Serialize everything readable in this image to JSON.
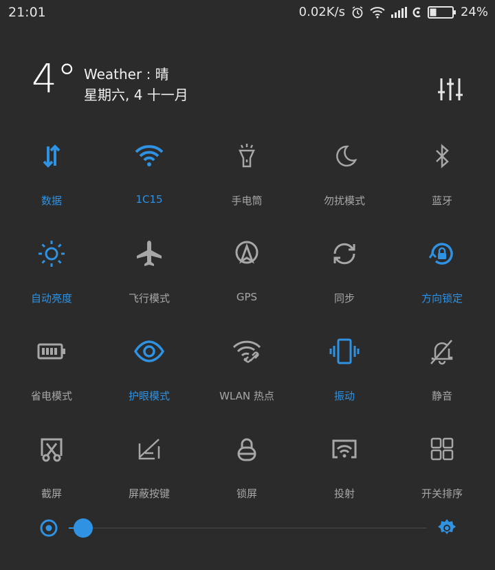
{
  "status_bar": {
    "time": "21:01",
    "net_speed": "0.02K/s",
    "battery": "24%"
  },
  "header": {
    "temperature": "4°",
    "weather": "Weather : 晴",
    "date": "星期六, 4 十一月"
  },
  "tiles": [
    {
      "label": "数据",
      "icon": "data-arrows-icon",
      "active": true
    },
    {
      "label": "1C15",
      "icon": "wifi-icon",
      "active": true
    },
    {
      "label": "手电筒",
      "icon": "flashlight-icon",
      "active": false
    },
    {
      "label": "勿扰模式",
      "icon": "moon-icon",
      "active": false
    },
    {
      "label": "蓝牙",
      "icon": "bluetooth-icon",
      "active": false
    },
    {
      "label": "自动亮度",
      "icon": "sun-icon",
      "active": true
    },
    {
      "label": "飞行模式",
      "icon": "airplane-icon",
      "active": false
    },
    {
      "label": "GPS",
      "icon": "gps-icon",
      "active": false
    },
    {
      "label": "同步",
      "icon": "sync-icon",
      "active": false
    },
    {
      "label": "方向锁定",
      "icon": "rotation-lock-icon",
      "active": true
    },
    {
      "label": "省电模式",
      "icon": "battery-saver-icon",
      "active": false
    },
    {
      "label": "护眼模式",
      "icon": "eye-icon",
      "active": true
    },
    {
      "label": "WLAN 热点",
      "icon": "hotspot-icon",
      "active": false
    },
    {
      "label": "振动",
      "icon": "vibrate-icon",
      "active": true
    },
    {
      "label": "静音",
      "icon": "bell-off-icon",
      "active": false
    },
    {
      "label": "截屏",
      "icon": "screenshot-icon",
      "active": false
    },
    {
      "label": "屏蔽按键",
      "icon": "block-keys-icon",
      "active": false
    },
    {
      "label": "锁屏",
      "icon": "lock-icon",
      "active": false
    },
    {
      "label": "投射",
      "icon": "cast-icon",
      "active": false
    },
    {
      "label": "开关排序",
      "icon": "grid-icon",
      "active": false
    }
  ],
  "brightness": {
    "level": 0.04
  },
  "colors": {
    "background": "#2b2b2b",
    "accent": "#2f92e2",
    "inactive": "#a7a7a7"
  }
}
